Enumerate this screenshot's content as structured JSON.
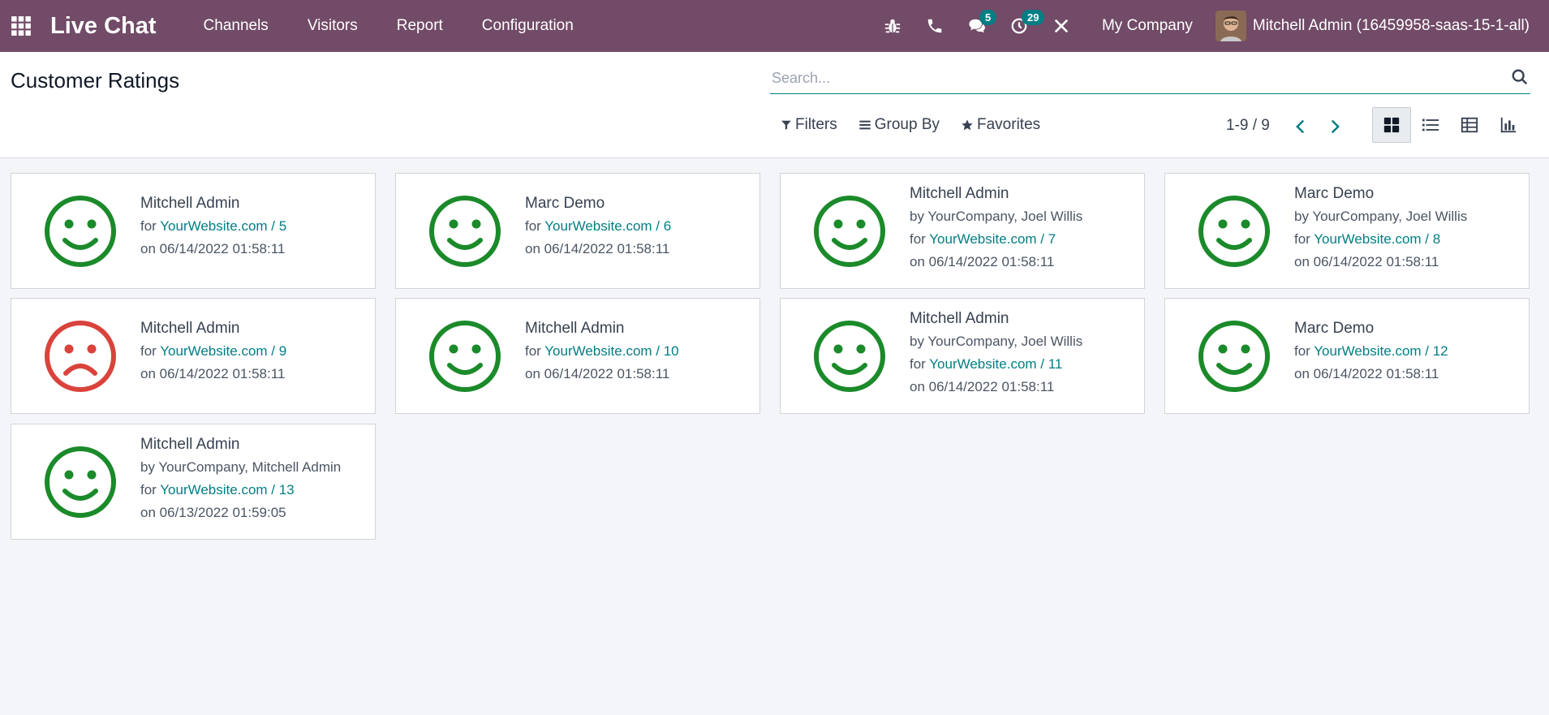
{
  "navbar": {
    "app_title": "Live Chat",
    "menu": [
      "Channels",
      "Visitors",
      "Report",
      "Configuration"
    ],
    "messages_badge": "5",
    "activities_badge": "29",
    "company": "My Company",
    "user": "Mitchell Admin (16459958-saas-15-1-all)"
  },
  "control": {
    "title": "Customer Ratings",
    "search_placeholder": "Search...",
    "filters_label": "Filters",
    "groupby_label": "Group By",
    "favorites_label": "Favorites",
    "pager": "1-9 / 9"
  },
  "colors": {
    "brand": "#714b67",
    "accent": "#017e84",
    "happy": "#1b8a2a",
    "sad": "#d9433b"
  },
  "cards": [
    {
      "name": "Mitchell Admin",
      "by": "",
      "for_prefix": "for ",
      "link": "YourWebsite.com / 5",
      "date": "on 06/14/2022 01:58:11",
      "rating": "happy"
    },
    {
      "name": "Marc Demo",
      "by": "",
      "for_prefix": "for ",
      "link": "YourWebsite.com / 6",
      "date": "on 06/14/2022 01:58:11",
      "rating": "happy"
    },
    {
      "name": "Mitchell Admin",
      "by": "by YourCompany, Joel Willis",
      "for_prefix": "for ",
      "link": "YourWebsite.com / 7",
      "date": "on 06/14/2022 01:58:11",
      "rating": "happy"
    },
    {
      "name": "Marc Demo",
      "by": "by YourCompany, Joel Willis",
      "for_prefix": "for ",
      "link": "YourWebsite.com / 8",
      "date": "on 06/14/2022 01:58:11",
      "rating": "happy"
    },
    {
      "name": "Mitchell Admin",
      "by": "",
      "for_prefix": "for ",
      "link": "YourWebsite.com / 9",
      "date": "on 06/14/2022 01:58:11",
      "rating": "sad"
    },
    {
      "name": "Mitchell Admin",
      "by": "",
      "for_prefix": "for ",
      "link": "YourWebsite.com / 10",
      "date": "on 06/14/2022 01:58:11",
      "rating": "happy"
    },
    {
      "name": "Mitchell Admin",
      "by": "by YourCompany, Joel Willis",
      "for_prefix": "for ",
      "link": "YourWebsite.com / 11",
      "date": "on 06/14/2022 01:58:11",
      "rating": "happy"
    },
    {
      "name": "Marc Demo",
      "by": "",
      "for_prefix": "for ",
      "link": "YourWebsite.com / 12",
      "date": "on 06/14/2022 01:58:11",
      "rating": "happy"
    },
    {
      "name": "Mitchell Admin",
      "by": "by YourCompany, Mitchell Admin",
      "for_prefix": "for ",
      "link": "YourWebsite.com / 13",
      "date": "on 06/13/2022 01:59:05",
      "rating": "happy"
    }
  ]
}
